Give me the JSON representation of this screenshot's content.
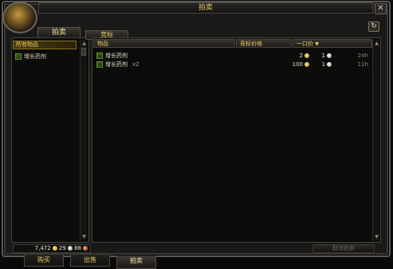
{
  "window": {
    "title": "拍卖"
  },
  "left": {
    "tab_label": "拍卖",
    "category_header": "所有物品",
    "items": [
      {
        "label": "增长药剂",
        "icon": "potion-icon"
      }
    ]
  },
  "right": {
    "tab_label": "竞标",
    "columns": {
      "item": "物品",
      "bid": "竞标价格",
      "buyout": "一口价"
    },
    "rows": [
      {
        "name": "增长药剂",
        "qty": "",
        "gold": "2",
        "silver": "1",
        "time": "24h"
      },
      {
        "name": "增长药剂",
        "qty": "x2",
        "gold": "100",
        "silver": "1",
        "time": "11h"
      }
    ]
  },
  "money": {
    "gold": "7,472",
    "silver": "29",
    "copper": "88"
  },
  "buttons": {
    "cancel": "取消拍卖"
  },
  "bottom_tabs": [
    "购买",
    "出售",
    "拍卖"
  ],
  "colors": {
    "accent": "#e8c860",
    "gold": "#ffd700"
  }
}
